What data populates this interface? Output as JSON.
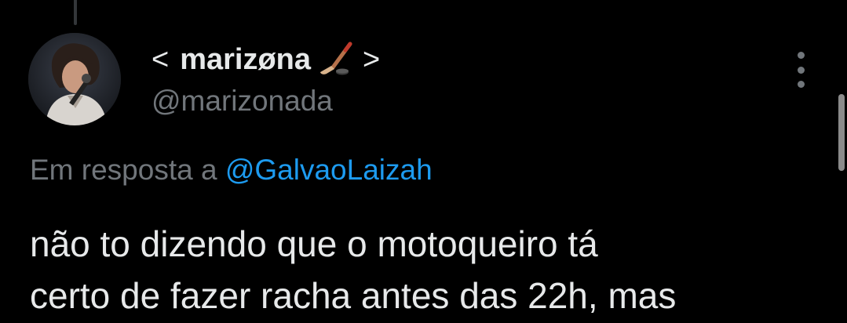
{
  "author": {
    "display_name_open": "<",
    "display_name": "marizøna",
    "display_name_emoji": "ice-hockey-emoji",
    "display_name_close": ">",
    "handle": "@marizonada"
  },
  "reply": {
    "prefix": "Em resposta a",
    "mention": "@GalvaoLaizah"
  },
  "tweet": {
    "lines": [
      "não to dizendo que o motoqueiro tá",
      "certo de fazer racha antes das 22h, mas"
    ]
  },
  "icons": {
    "more": "more-vertical-icon",
    "avatar": "profile-photo"
  },
  "colors": {
    "background": "#000000",
    "text": "#e7e9ea",
    "secondary": "#71767b",
    "mention": "#1d9bf0"
  }
}
